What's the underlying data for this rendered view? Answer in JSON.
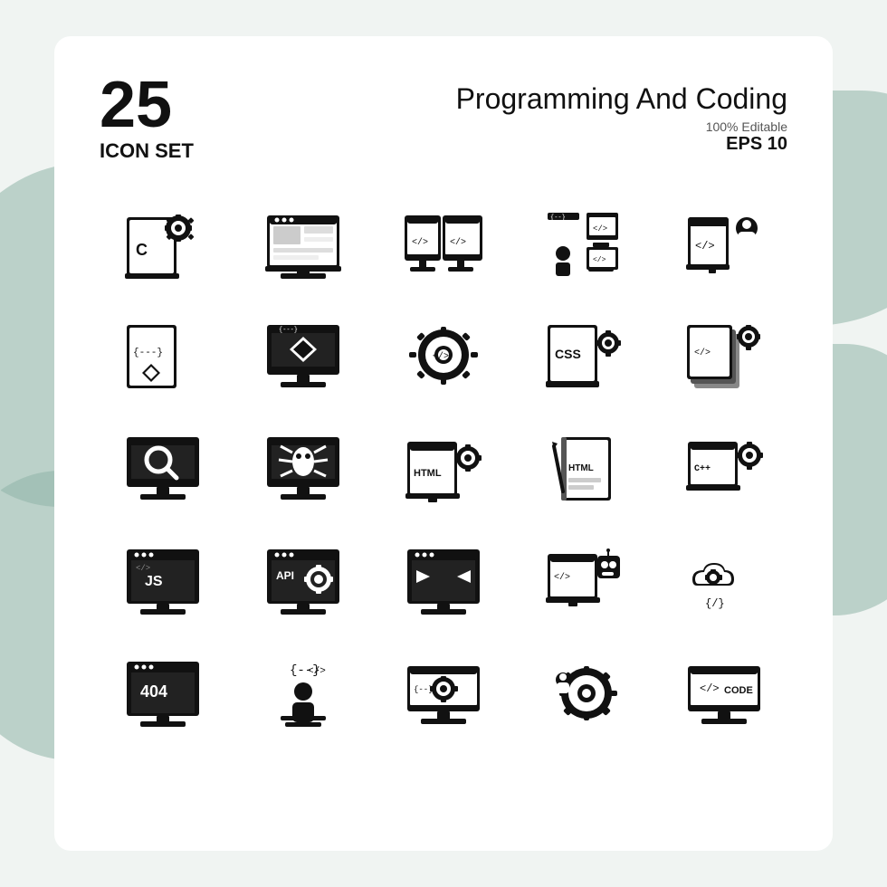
{
  "header": {
    "number": "25",
    "icon_set_label": "ICON SET",
    "title": "Programming And Coding",
    "editable": "100% Editable",
    "eps": "EPS 10"
  },
  "icons": [
    {
      "name": "c-programming-file",
      "label": "C file with gear"
    },
    {
      "name": "web-layout",
      "label": "Web layout"
    },
    {
      "name": "dual-monitor-code",
      "label": "Dual monitor code"
    },
    {
      "name": "remote-learning",
      "label": "Remote coding learning"
    },
    {
      "name": "code-tag-person",
      "label": "Code tag with person"
    },
    {
      "name": "ruby-code-file",
      "label": "Ruby code file"
    },
    {
      "name": "diamond-monitor",
      "label": "Diamond on monitor"
    },
    {
      "name": "code-gear",
      "label": "Code gear"
    },
    {
      "name": "css-settings",
      "label": "CSS settings"
    },
    {
      "name": "layers-gear",
      "label": "Layers with gear"
    },
    {
      "name": "search-monitor",
      "label": "Search monitor"
    },
    {
      "name": "bug-monitor",
      "label": "Bug monitor"
    },
    {
      "name": "html-settings",
      "label": "HTML settings"
    },
    {
      "name": "html-book",
      "label": "HTML book"
    },
    {
      "name": "cpp-laptop",
      "label": "C++ laptop code"
    },
    {
      "name": "js-browser",
      "label": "JS browser"
    },
    {
      "name": "api-settings",
      "label": "API settings"
    },
    {
      "name": "code-window",
      "label": "Code window arrows"
    },
    {
      "name": "robot-monitor",
      "label": "Robot on monitor"
    },
    {
      "name": "cloud-gear",
      "label": "Cloud with gear"
    },
    {
      "name": "404-browser",
      "label": "404 browser"
    },
    {
      "name": "coder-person",
      "label": "Coder person"
    },
    {
      "name": "code-monitor-gear",
      "label": "Code monitor gear"
    },
    {
      "name": "gear-cog-person",
      "label": "Gear cog with person"
    },
    {
      "name": "code-monitor",
      "label": "Code monitor"
    }
  ],
  "colors": {
    "icon_fill": "#111111",
    "background": "#f0f4f2",
    "card": "#ffffff",
    "blob": "#8fb5a8"
  }
}
